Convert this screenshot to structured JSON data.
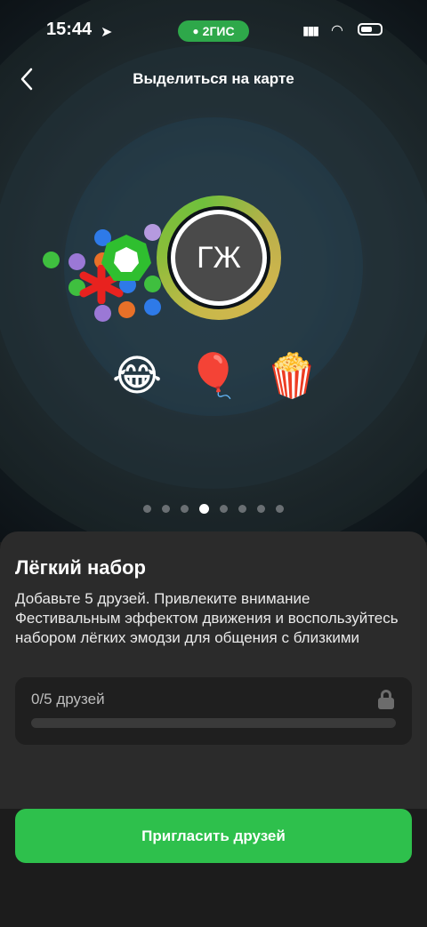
{
  "status_bar": {
    "time": "15:44",
    "app_badge": "2ГИС"
  },
  "header": {
    "back_icon": "chevron-left-icon",
    "title": "Выделиться на карте"
  },
  "avatar": {
    "initials": "ГЖ"
  },
  "emojis": [
    "😂",
    "🎈",
    "🍿"
  ],
  "pager": {
    "total": 8,
    "active_index": 3
  },
  "sheet": {
    "heading": "Лёгкий набор",
    "description": "Добавьте 5 друзей. Привлеките внимание Фестивальным эффектом движения и воспользуйтесь набором лёгких эмодзи для общения с близкими",
    "progress": {
      "label": "0/5 друзей",
      "current": 0,
      "total": 5,
      "lock_icon": "lock-icon"
    }
  },
  "cta": {
    "label": "Пригласить друзей"
  },
  "colors": {
    "accent": "#2ec04c",
    "sheet_bg": "#2b2b2b"
  }
}
